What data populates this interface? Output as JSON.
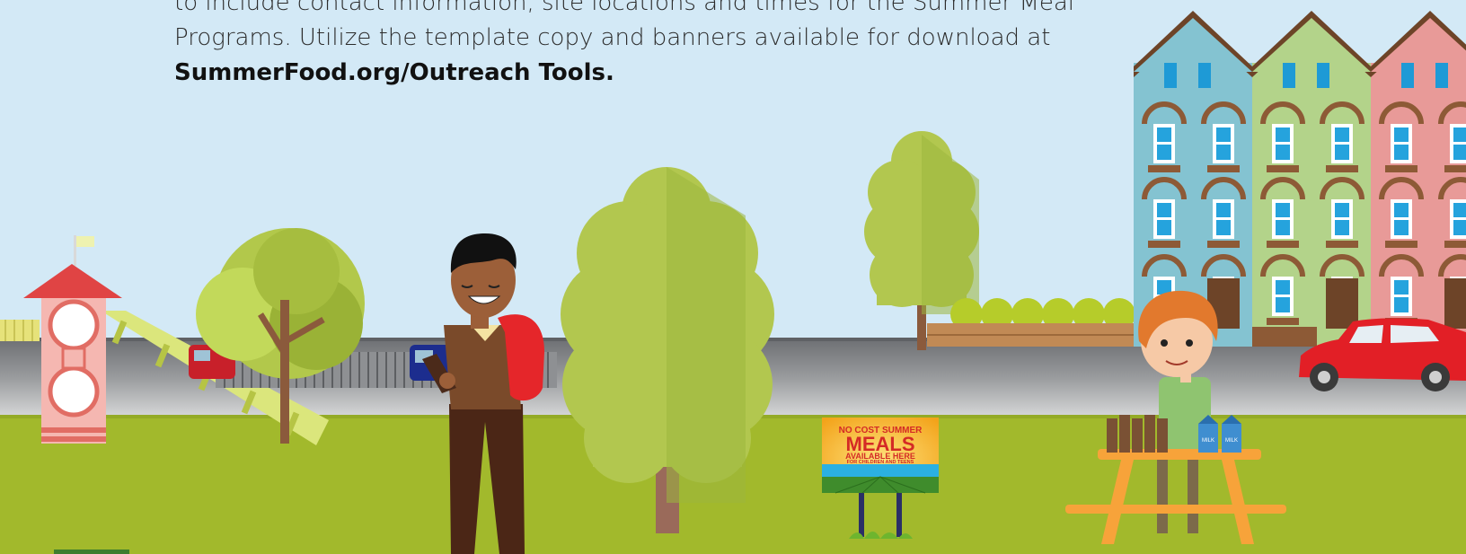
{
  "intro": {
    "line1": "to include contact information, site locations and times for the Summer Meal",
    "line2": "Programs. Utilize the template copy and banners available for download at",
    "link": "SummerFood.org/Outreach Tools."
  },
  "sign": {
    "line1": "NO COST SUMMER",
    "line2": "MEALS",
    "line3": "AVAILABLE HERE",
    "line4": "FOR CHILDREN AND TEENS"
  },
  "milk_carton_label": "MILK",
  "colors": {
    "sky": "#d3e9f6",
    "grass": "#a2b92c",
    "road": "#77797c",
    "house_blue": "#84c3d1",
    "house_green": "#b3d38a",
    "house_pink": "#e89a98",
    "car_red": "#e21f26",
    "sign_yellow": "#f7b81c",
    "sign_red": "#d42a25"
  }
}
